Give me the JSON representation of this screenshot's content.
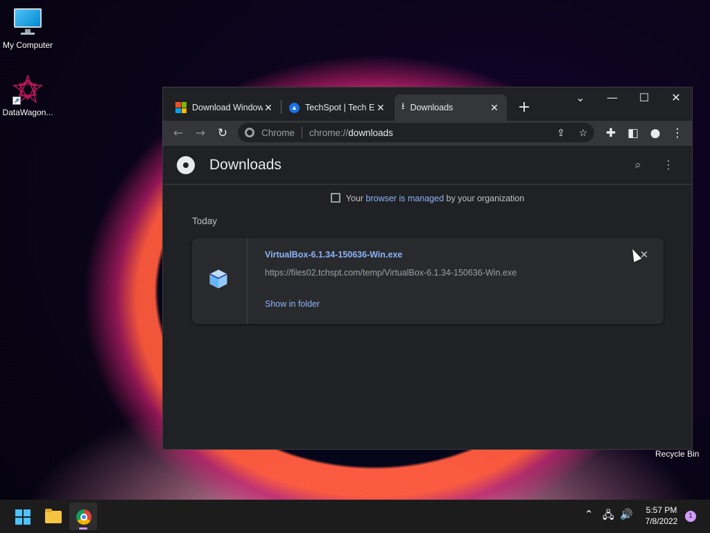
{
  "desktop": {
    "icons": [
      {
        "label": "My Computer"
      },
      {
        "label": "DataWagon..."
      }
    ],
    "recycle_bin": "Recycle Bin"
  },
  "browser": {
    "tabs": [
      {
        "title": "Download Windows",
        "close": "✕"
      },
      {
        "title": "TechSpot | Tech Enthusiasts",
        "close": "✕"
      },
      {
        "title": "Downloads",
        "close": "✕"
      }
    ],
    "new_tab": "+",
    "window_controls": {
      "tab_search": "⌄",
      "minimize": "—",
      "maximize": "☐",
      "close": "✕"
    },
    "nav": {
      "back": "←",
      "forward": "→",
      "reload": "↻"
    },
    "omnibox": {
      "label": "Chrome",
      "scheme": "chrome://",
      "host": "downloads"
    },
    "toolbar_icons": {
      "share": "⇪",
      "bookmark": "☆",
      "extensions": "✚",
      "side_panel": "◧",
      "profile": "●",
      "menu": "⋮"
    }
  },
  "downloads_page": {
    "title": "Downloads",
    "search": "⌕",
    "more": "⋮",
    "managed_notice": {
      "prefix": "Your",
      "link1": "browser",
      "middle": "is",
      "link2": "managed",
      "suffix": "by your organization"
    },
    "date_group": "Today",
    "items": [
      {
        "file_name": "VirtualBox-6.1.34-150636-Win.exe",
        "url": "https://files02.tchspt.com/temp/VirtualBox-6.1.34-150636-Win.exe",
        "action": "Show in folder",
        "remove": "✕"
      }
    ]
  },
  "taskbar": {
    "tray": {
      "chevron": "⌃",
      "network": "🖧",
      "volume": "🔊"
    },
    "clock": {
      "time": "5:57 PM",
      "date": "7/8/2022"
    },
    "notifications": "1"
  },
  "colors": {
    "accent": "#8ab4f8",
    "tab_active": "#35363a",
    "page_bg": "#202124",
    "card_bg": "#292a2d"
  }
}
